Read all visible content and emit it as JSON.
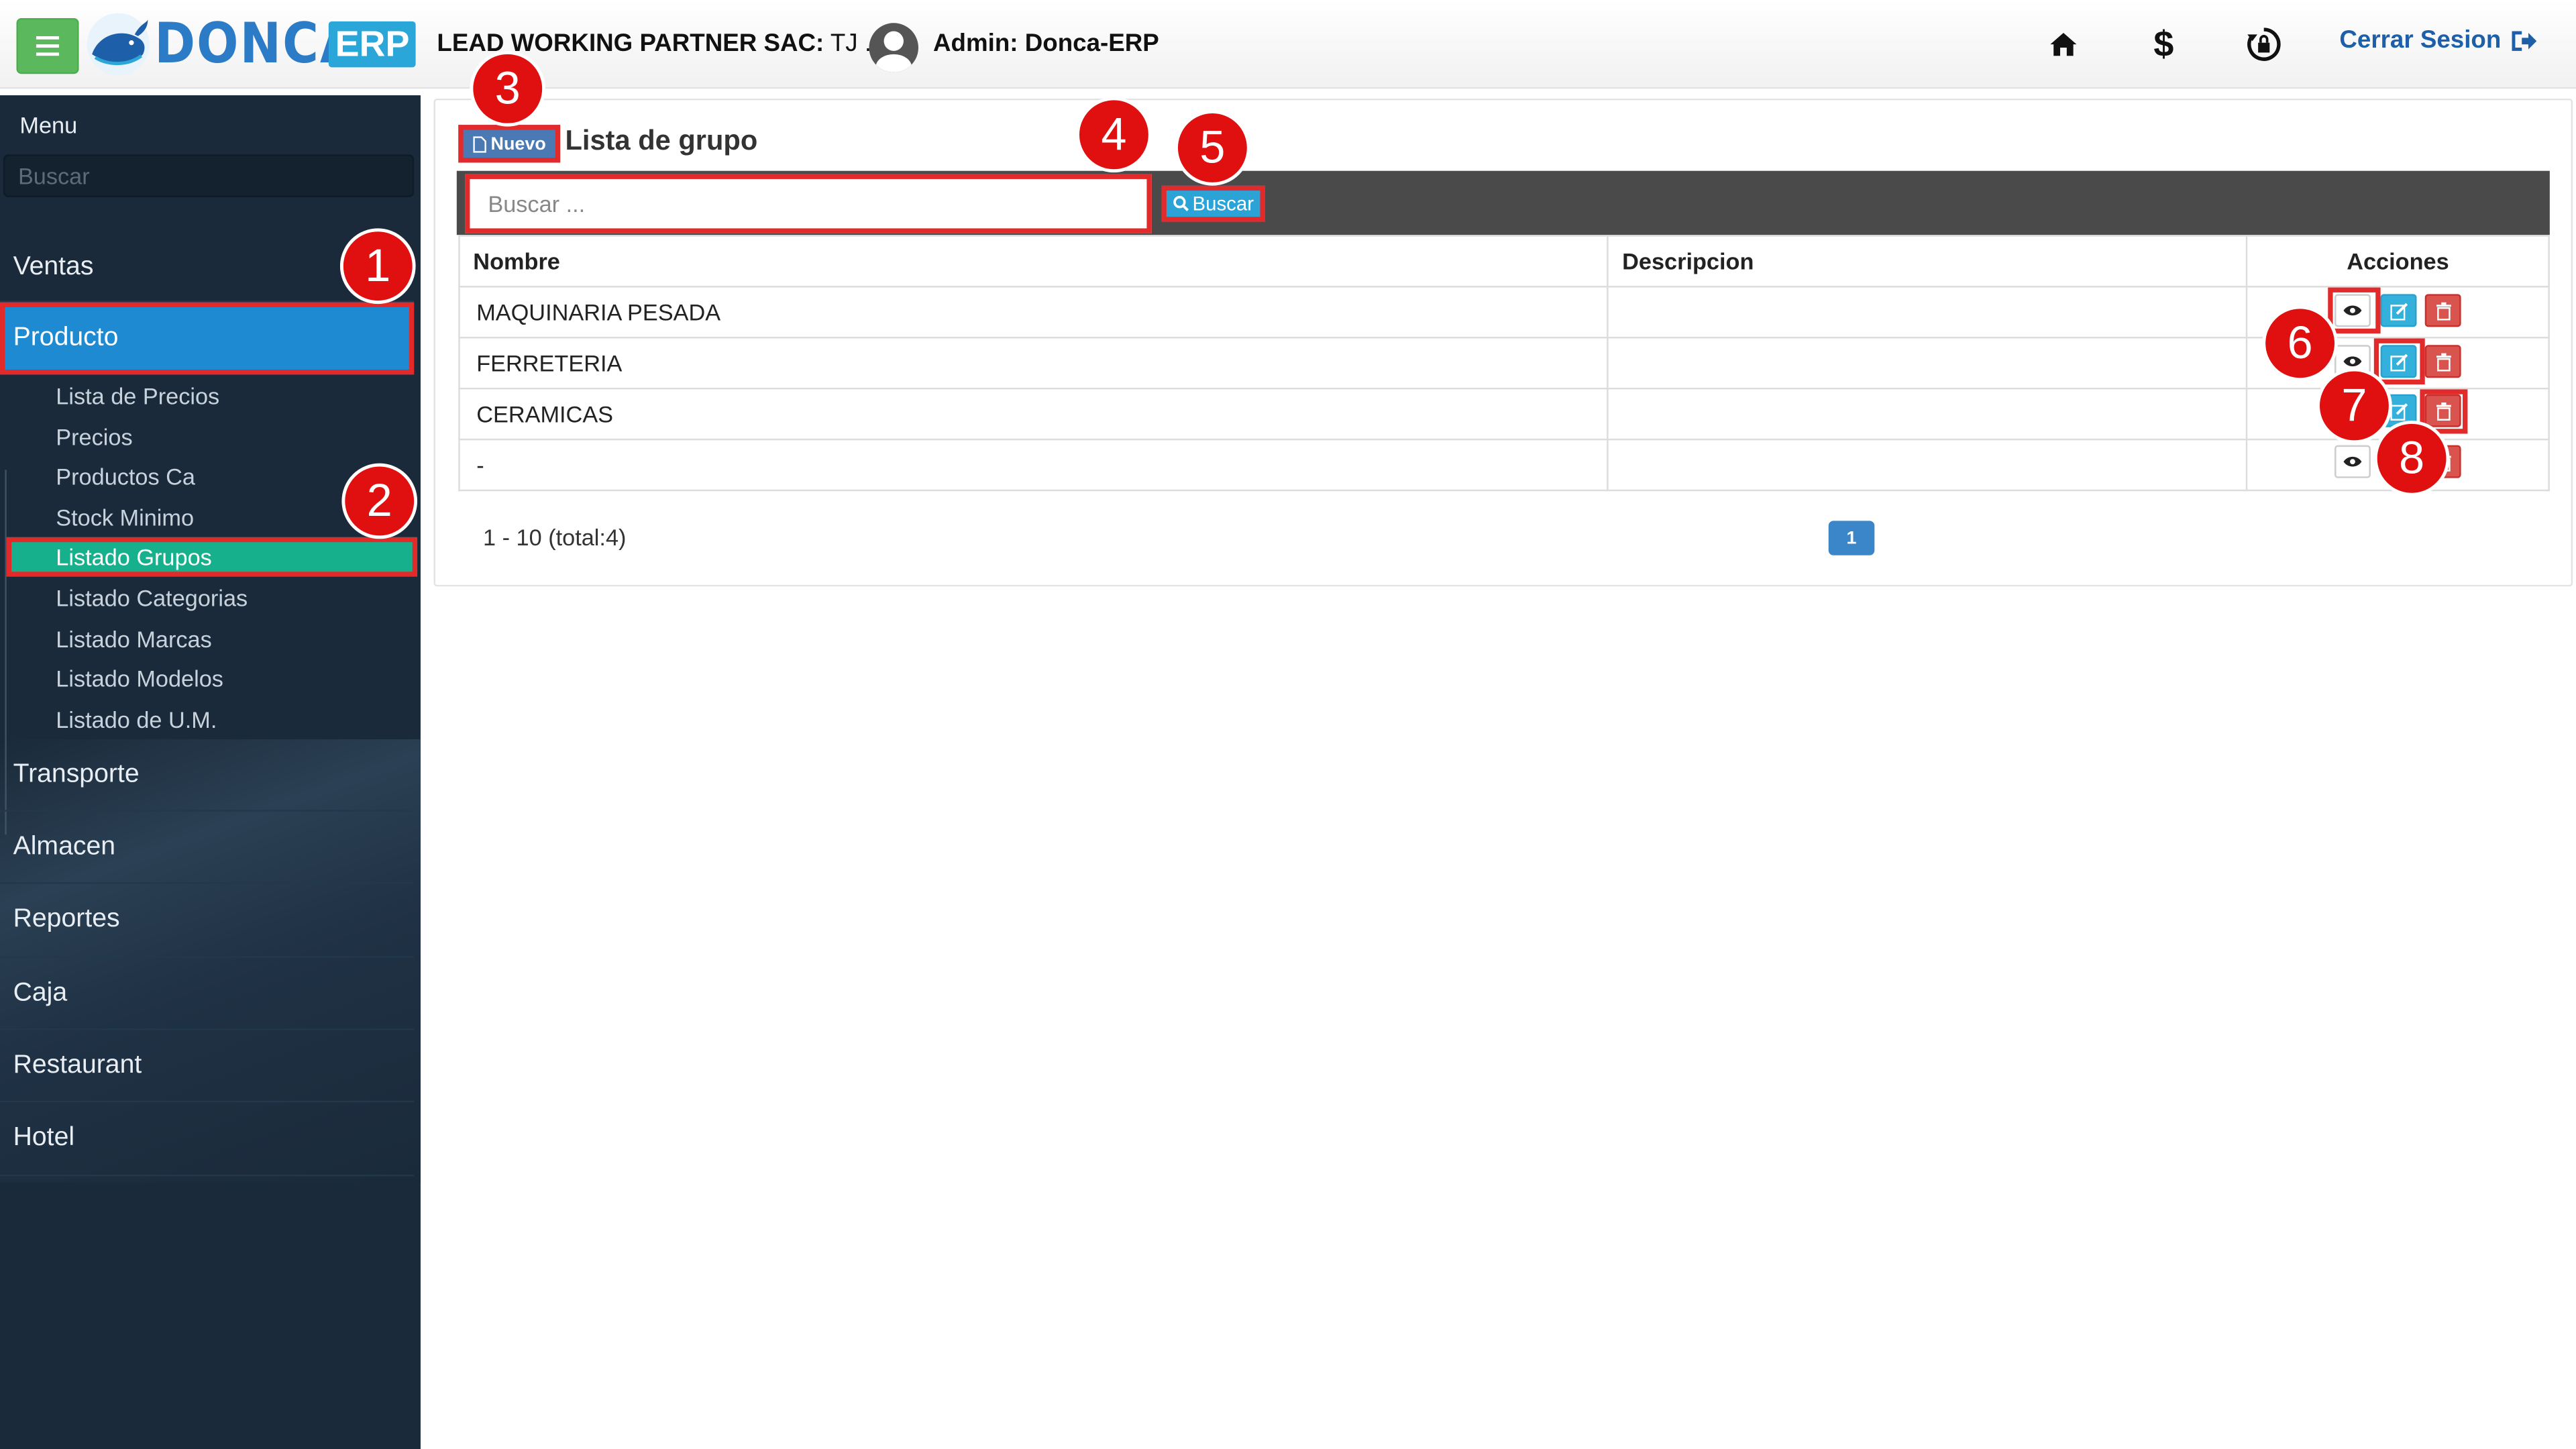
{
  "header": {
    "brand": "DONCA",
    "brand_suffix": "ERP",
    "company": "LEAD WORKING PARTNER SAC:",
    "company_suffix": " TJ . |",
    "admin": "Admin: Donca-ERP",
    "logout": "Cerrar Sesion"
  },
  "sidebar": {
    "menu_label": "Menu",
    "search_placeholder": "Buscar",
    "items": [
      {
        "label": "Ventas"
      },
      {
        "label": "Producto"
      },
      {
        "label": "Transporte"
      },
      {
        "label": "Almacen"
      },
      {
        "label": "Reportes"
      },
      {
        "label": "Caja"
      },
      {
        "label": "Restaurant"
      },
      {
        "label": "Hotel"
      }
    ],
    "producto_sub": [
      {
        "label": "Lista de Precios"
      },
      {
        "label": "Precios"
      },
      {
        "label": "Productos Ca"
      },
      {
        "label": "Stock Minimo"
      },
      {
        "label": "Listado Grupos"
      },
      {
        "label": "Listado Categorias"
      },
      {
        "label": "Listado Marcas"
      },
      {
        "label": "Listado Modelos"
      },
      {
        "label": "Listado de U.M."
      }
    ]
  },
  "main": {
    "new_button": "Nuevo",
    "title": "Lista de grupo",
    "search_placeholder": "Buscar ...",
    "search_button": "Buscar",
    "columns": [
      "Nombre",
      "Descripcion",
      "Acciones"
    ],
    "rows": [
      {
        "nombre": "MAQUINARIA PESADA",
        "descripcion": ""
      },
      {
        "nombre": "FERRETERIA",
        "descripcion": ""
      },
      {
        "nombre": "CERAMICAS",
        "descripcion": ""
      },
      {
        "nombre": "-",
        "descripcion": ""
      }
    ],
    "pagination_info": "1 - 10 (total:4)",
    "current_page": "1"
  },
  "annotations": [
    "1",
    "2",
    "3",
    "4",
    "5",
    "6",
    "7",
    "8"
  ],
  "colors": {
    "sidebar_bg": "#1a2a3a",
    "active_item": "#1d8ad1",
    "active_sub": "#17b08d",
    "highlight": "#e22a2a",
    "badge": "#e01010"
  }
}
